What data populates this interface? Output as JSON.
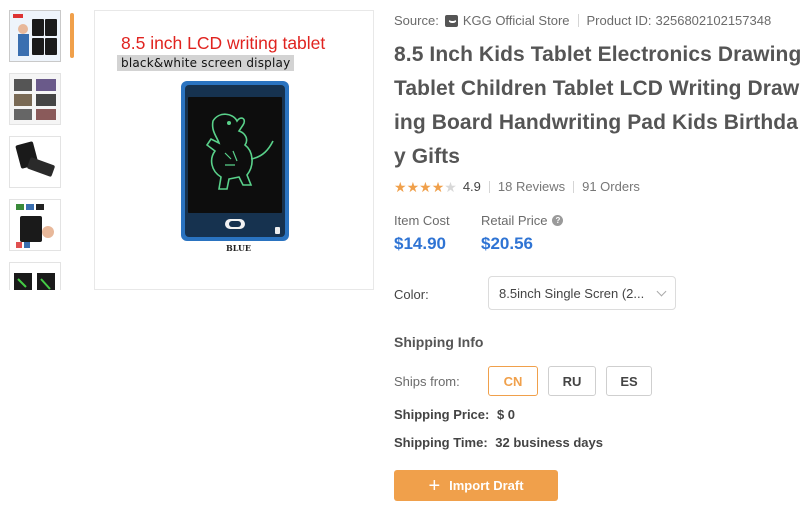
{
  "source": {
    "label": "Source:",
    "store": "KGG Official Store",
    "product_id_label": "Product ID:",
    "product_id": "3256802102157348"
  },
  "product": {
    "title": "8.5 Inch Kids Tablet Electronics Drawing Tablet Children Tablet LCD Writing Drawing Board Handwriting Pad Kids Birthday Gifts",
    "rating_value": 4.9,
    "rating": "4.9",
    "reviews": "18 Reviews",
    "orders": "91 Orders"
  },
  "image": {
    "caption": "8.5 inch LCD writing tablet",
    "subcaption": "black&white screen display",
    "device_label": "BLUE"
  },
  "pricing": {
    "item_cost_label": "Item Cost",
    "item_cost": "$14.90",
    "retail_price_label": "Retail Price",
    "retail_price": "$20.56"
  },
  "variant": {
    "color_label": "Color:",
    "color_value": "8.5inch Single Scren (2..."
  },
  "shipping": {
    "heading": "Shipping Info",
    "ships_from_label": "Ships from:",
    "countries": [
      "CN",
      "RU",
      "ES"
    ],
    "selected_country": "CN",
    "price_label": "Shipping Price:",
    "price": "$ 0",
    "time_label": "Shipping Time:",
    "time": "32 business days"
  },
  "actions": {
    "import_label": "Import Draft"
  },
  "colors": {
    "accent": "#f0a04b",
    "price": "#2f74d4"
  }
}
